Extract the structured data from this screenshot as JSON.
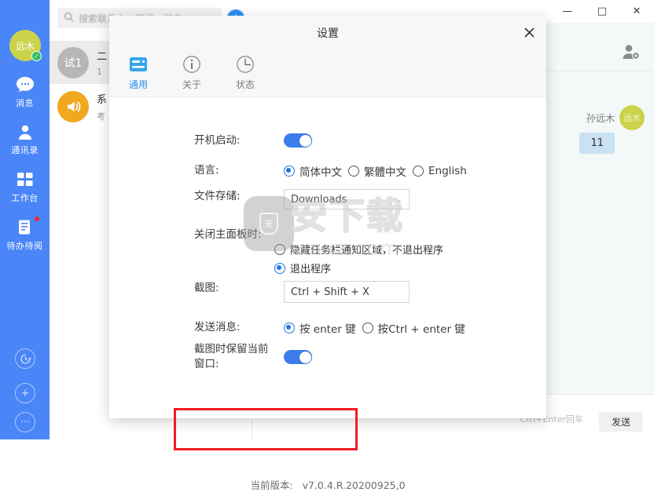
{
  "app": {
    "sidebar": {
      "avatar_text": "远木",
      "status_icon": "check-icon",
      "items": [
        {
          "label": "消息",
          "icon": "chat-bubble-icon",
          "active": true,
          "badge": false
        },
        {
          "label": "通讯录",
          "icon": "contacts-person-icon",
          "active": false,
          "badge": false
        },
        {
          "label": "工作台",
          "icon": "grid-apps-icon",
          "active": false,
          "badge": false
        },
        {
          "label": "待办待阅",
          "icon": "todo-list-icon",
          "active": false,
          "badge": true
        }
      ],
      "bottom_icons": [
        "history-clock-icon",
        "plus-icon",
        "more-dots-icon"
      ]
    },
    "search": {
      "placeholder": "搜索联系人、群组、消息",
      "icon": "search-icon",
      "add_button_icon": "add-icon"
    },
    "chat_list": [
      {
        "avatar_text": "试1",
        "title": "二",
        "snippet": "1",
        "selected": true
      },
      {
        "avatar_text": "",
        "avatar_icon": "megaphone-icon",
        "title": "系",
        "snippet": "考",
        "selected": false
      }
    ],
    "titlebar": {
      "minimize": "—",
      "maximize": "□",
      "close": "✕"
    },
    "conversation": {
      "add_person_icon": "add-person-icon",
      "messages": [
        {
          "sender": "孙远木",
          "avatar_text": "远木",
          "text": "11",
          "side": "right"
        }
      ],
      "composer_hint": "Ctrl+Enter回车",
      "send_label": "发送"
    }
  },
  "dialog": {
    "title": "设置",
    "close_icon": "close-icon",
    "tabs": [
      {
        "label": "通用",
        "icon": "card-general-icon",
        "active": true
      },
      {
        "label": "关于",
        "icon": "info-circle-icon",
        "active": false
      },
      {
        "label": "状态",
        "icon": "clock-circle-icon",
        "active": false
      }
    ],
    "settings": {
      "startup": {
        "label": "开机启动:",
        "toggle_on": true
      },
      "language": {
        "label": "语言:",
        "options": [
          "简体中文",
          "繁體中文",
          "English"
        ],
        "selected_index": 0
      },
      "file_storage": {
        "label": "文件存储:",
        "value": "Downloads",
        "chevron": "⌄"
      },
      "close_behavior": {
        "label": "关闭主面板时:",
        "options": [
          "隐藏任务栏通知区域，不退出程序",
          "退出程序"
        ],
        "selected_index": 1
      },
      "screenshot": {
        "label": "截图:",
        "value": "Ctrl + Shift + X"
      },
      "send_message": {
        "label": "发送消息:",
        "options": [
          "按 enter 键",
          "按Ctrl + enter 键"
        ],
        "selected_index": 0
      },
      "keep_window": {
        "label_line1": "截图时保留当前",
        "label_line2": "窗口:",
        "toggle_on": true,
        "highlighted": true,
        "highlight_color": "#ee1c25"
      }
    },
    "version": {
      "label": "当前版本:",
      "value": "v7.0.4.R.20200925,0"
    }
  },
  "watermark": {
    "text": "安下载",
    "subtext": "anxz.com",
    "badge_text": "安"
  },
  "colors": {
    "sidebar_blue": "#4a86f7",
    "accent_blue": "#2d8cf0",
    "toggle_blue": "#3b7ded",
    "avatar_green": "#cbd34a",
    "highlight_red": "#ee1c25",
    "bubble_blue": "#c9e1f2"
  }
}
